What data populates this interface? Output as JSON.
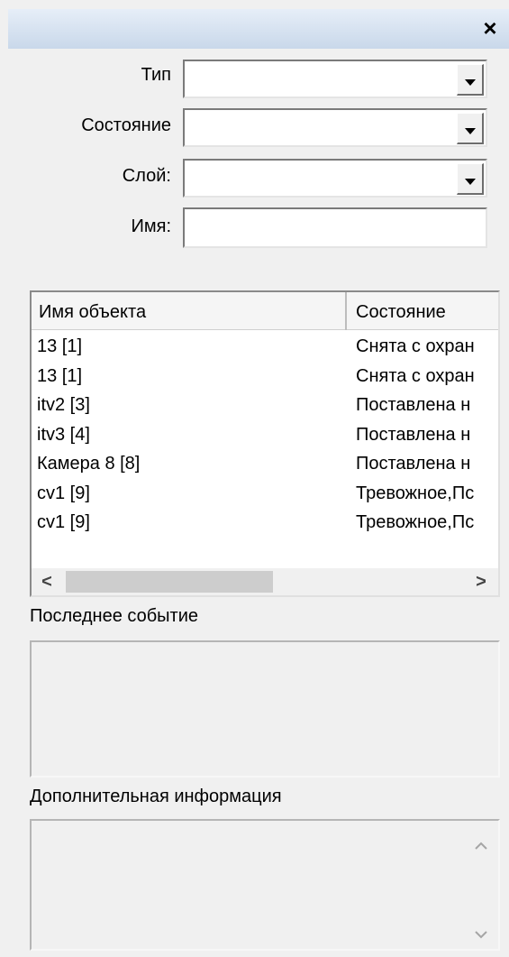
{
  "window": {
    "close_glyph": "×"
  },
  "filters": {
    "type_label": "Тип",
    "type_value": "",
    "state_label": "Состояние",
    "state_value": "",
    "layer_label": "Слой:",
    "layer_value": "",
    "name_label": "Имя:",
    "name_value": ""
  },
  "list": {
    "columns": [
      "Имя объекта",
      "Состояние"
    ],
    "rows": [
      {
        "name": "13 [1]",
        "state": "Снята с охран"
      },
      {
        "name": "13 [1]",
        "state": "Снята с охран"
      },
      {
        "name": "itv2 [3]",
        "state": "Поставлена н"
      },
      {
        "name": "itv3 [4]",
        "state": "Поставлена н"
      },
      {
        "name": "Камера 8 [8]",
        "state": "Поставлена н"
      },
      {
        "name": "cv1 [9]",
        "state": "Тревожное,Пс"
      },
      {
        "name": "cv1 [9]",
        "state": "Тревожное,Пс"
      }
    ],
    "scroll_left_glyph": "<",
    "scroll_right_glyph": ">"
  },
  "last_event": {
    "label": "Последнее событие",
    "text": ""
  },
  "additional_info": {
    "label": "Дополнительная информация",
    "text": "",
    "scroll_up_icon": "chevron-up-icon",
    "scroll_down_icon": "chevron-down-icon"
  },
  "colors": {
    "titlebar": "#c9d8ea",
    "panel": "#f0f0f0",
    "field": "#ffffff"
  }
}
